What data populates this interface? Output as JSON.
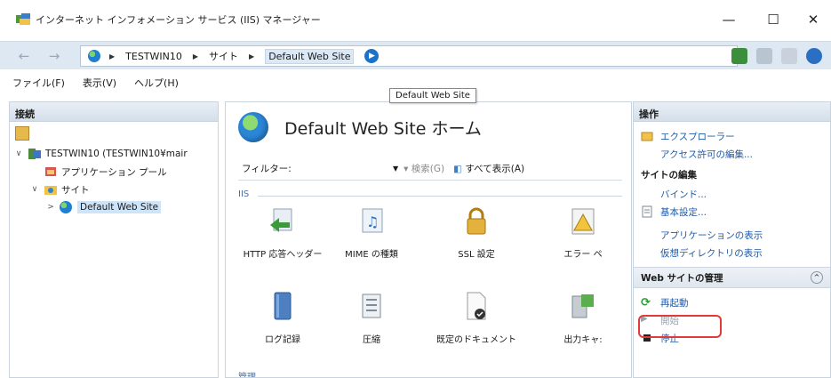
{
  "window": {
    "title": "インターネット インフォメーション サービス (IIS) マネージャー",
    "minimize": "—",
    "maximize": "☐",
    "close": "✕"
  },
  "address": {
    "back": "←",
    "forward": "→",
    "crumbs": [
      "TESTWIN10",
      "サイト",
      "Default Web Site"
    ],
    "go": "▶",
    "sep": "▶"
  },
  "menu": [
    "ファイル(F)",
    "表示(V)",
    "ヘルプ(H)"
  ],
  "tooltip": "Default Web Site",
  "left": {
    "header": "接続",
    "tree": [
      {
        "label": "TESTWIN10 (TESTWIN10¥mair",
        "expander": "∨",
        "level": 0
      },
      {
        "label": "アプリケーション プール",
        "expander": "",
        "level": 1
      },
      {
        "label": "サイト",
        "expander": "∨",
        "level": 1
      },
      {
        "label": "Default Web Site",
        "expander": ">",
        "level": 2
      }
    ]
  },
  "center": {
    "title": "Default Web Site ホーム",
    "filter_label": "フィルター:",
    "filter_dropdown": "▼",
    "search": "検索(G)",
    "show_all": "すべて表示(A)",
    "group_iis": "IIS",
    "group_mgmt": "管理",
    "features": [
      {
        "label": "HTTP 応答ヘッダー",
        "icon": "http-response-headers-icon"
      },
      {
        "label": "MIME の種類",
        "icon": "mime-types-icon"
      },
      {
        "label": "SSL 設定",
        "icon": "ssl-lock-icon"
      },
      {
        "label": "エラー ペ",
        "icon": "error-pages-icon"
      },
      {
        "label": "ログ記録",
        "icon": "logging-icon"
      },
      {
        "label": "圧縮",
        "icon": "compression-icon"
      },
      {
        "label": "既定のドキュメント",
        "icon": "default-document-icon"
      },
      {
        "label": "出力キャ:",
        "icon": "output-caching-icon"
      }
    ]
  },
  "right": {
    "header": "操作",
    "explore": "エクスプローラー",
    "edit_permissions": "アクセス許可の編集...",
    "edit_site_title": "サイトの編集",
    "bindings": "バインド...",
    "basic_settings": "基本設定...",
    "view_applications": "アプリケーションの表示",
    "view_virtual_dirs": "仮想ディレクトリの表示",
    "manage_title": "Web サイトの管理",
    "collapse": "^",
    "restart": "再起動",
    "start": "開始",
    "stop": "停止"
  }
}
